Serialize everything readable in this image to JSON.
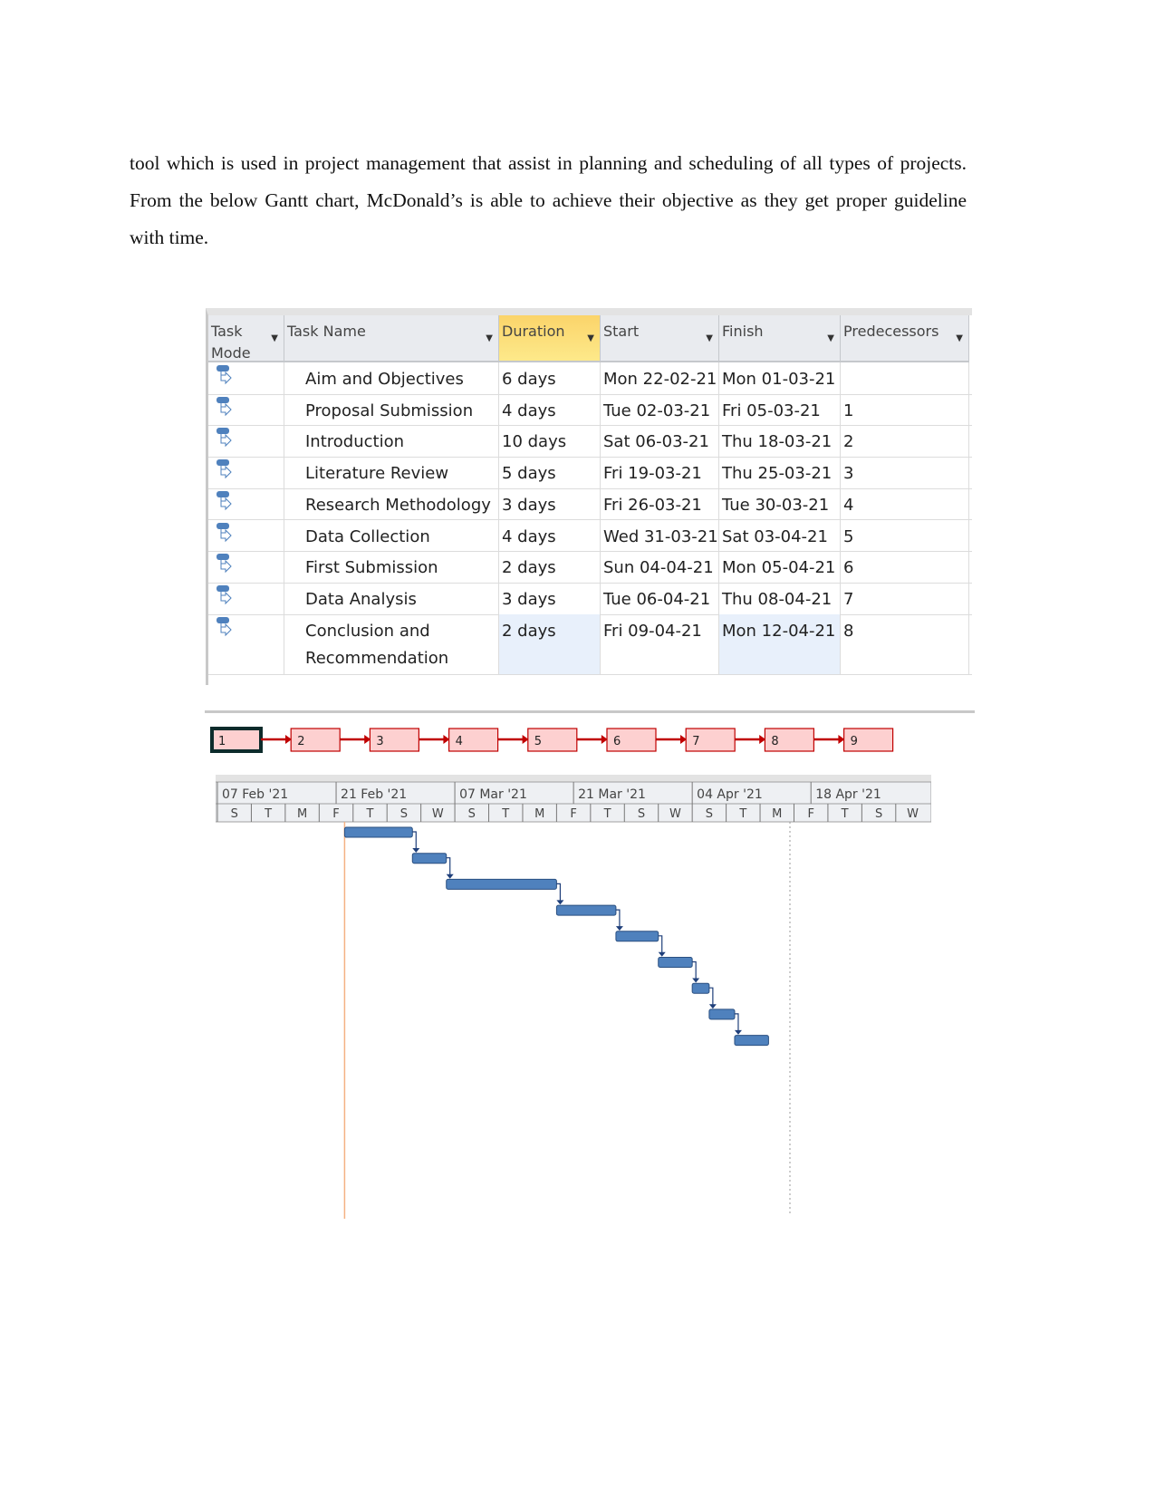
{
  "paragraph": "tool which is used in project management that assist in planning and scheduling of all types of projects. From the below Gantt chart, McDonald’s is able to achieve their objective as they get proper guideline with time.",
  "table": {
    "headers": [
      "Task Mode",
      "Task Name",
      "Duration",
      "Start",
      "Finish",
      "Predecessors"
    ],
    "rows": [
      {
        "mode": "auto-scheduled-icon",
        "name": "Aim and Objectives",
        "duration": "6 days",
        "start": "Mon 22-02-21",
        "finish": "Mon 01-03-21",
        "pred": ""
      },
      {
        "mode": "auto-scheduled-icon",
        "name": "Proposal Submission",
        "duration": "4 days",
        "start": "Tue 02-03-21",
        "finish": "Fri 05-03-21",
        "pred": "1"
      },
      {
        "mode": "auto-scheduled-icon",
        "name": "Introduction",
        "duration": "10 days",
        "start": "Sat 06-03-21",
        "finish": "Thu 18-03-21",
        "pred": "2"
      },
      {
        "mode": "auto-scheduled-icon",
        "name": "Literature Review",
        "duration": "5 days",
        "start": "Fri 19-03-21",
        "finish": "Thu 25-03-21",
        "pred": "3"
      },
      {
        "mode": "auto-scheduled-icon",
        "name": "Research Methodology",
        "duration": "3 days",
        "start": "Fri 26-03-21",
        "finish": "Tue 30-03-21",
        "pred": "4"
      },
      {
        "mode": "auto-scheduled-icon",
        "name": "Data Collection",
        "duration": "4 days",
        "start": "Wed 31-03-21",
        "finish": "Sat 03-04-21",
        "pred": "5"
      },
      {
        "mode": "auto-scheduled-icon",
        "name": "First Submission",
        "duration": "2 days",
        "start": "Sun 04-04-21",
        "finish": "Mon 05-04-21",
        "pred": "6"
      },
      {
        "mode": "auto-scheduled-icon",
        "name": "Data Analysis",
        "duration": "3 days",
        "start": "Tue 06-04-21",
        "finish": "Thu 08-04-21",
        "pred": "7"
      },
      {
        "mode": "auto-scheduled-icon",
        "name": "Conclusion and Recommendation",
        "name_lines": [
          "Conclusion and",
          "Recommendation"
        ],
        "duration": "2 days",
        "start": "Fri 09-04-21",
        "finish": "Mon 12-04-21",
        "pred": "8"
      }
    ]
  },
  "network": {
    "nodes": [
      "1",
      "2",
      "3",
      "4",
      "5",
      "6",
      "7",
      "8",
      "9"
    ],
    "selected": "1",
    "node_fill": "#fdd0d0",
    "link_color": "#c00000"
  },
  "chart_data": {
    "type": "gantt",
    "timeline_majors": [
      "07 Feb '21",
      "21 Feb '21",
      "07 Mar '21",
      "21 Mar '21",
      "04 Apr '21",
      "18 Apr '21"
    ],
    "timeline_minors": [
      "S",
      "T",
      "M",
      "F",
      "T",
      "S",
      "W",
      "S",
      "T",
      "M",
      "F",
      "T",
      "S",
      "W",
      "S",
      "T",
      "M",
      "F",
      "T",
      "S",
      "W"
    ],
    "axis_start": "2021-02-07",
    "tasks": [
      {
        "start": "2021-02-22",
        "finish": "2021-03-01"
      },
      {
        "start": "2021-03-02",
        "finish": "2021-03-05"
      },
      {
        "start": "2021-03-06",
        "finish": "2021-03-18"
      },
      {
        "start": "2021-03-19",
        "finish": "2021-03-25"
      },
      {
        "start": "2021-03-26",
        "finish": "2021-03-30"
      },
      {
        "start": "2021-03-31",
        "finish": "2021-04-03"
      },
      {
        "start": "2021-04-04",
        "finish": "2021-04-05"
      },
      {
        "start": "2021-04-06",
        "finish": "2021-04-08"
      },
      {
        "start": "2021-04-09",
        "finish": "2021-04-12"
      }
    ],
    "bar_color": "#4f81bd",
    "project_start_line_color": "#f4b183"
  }
}
